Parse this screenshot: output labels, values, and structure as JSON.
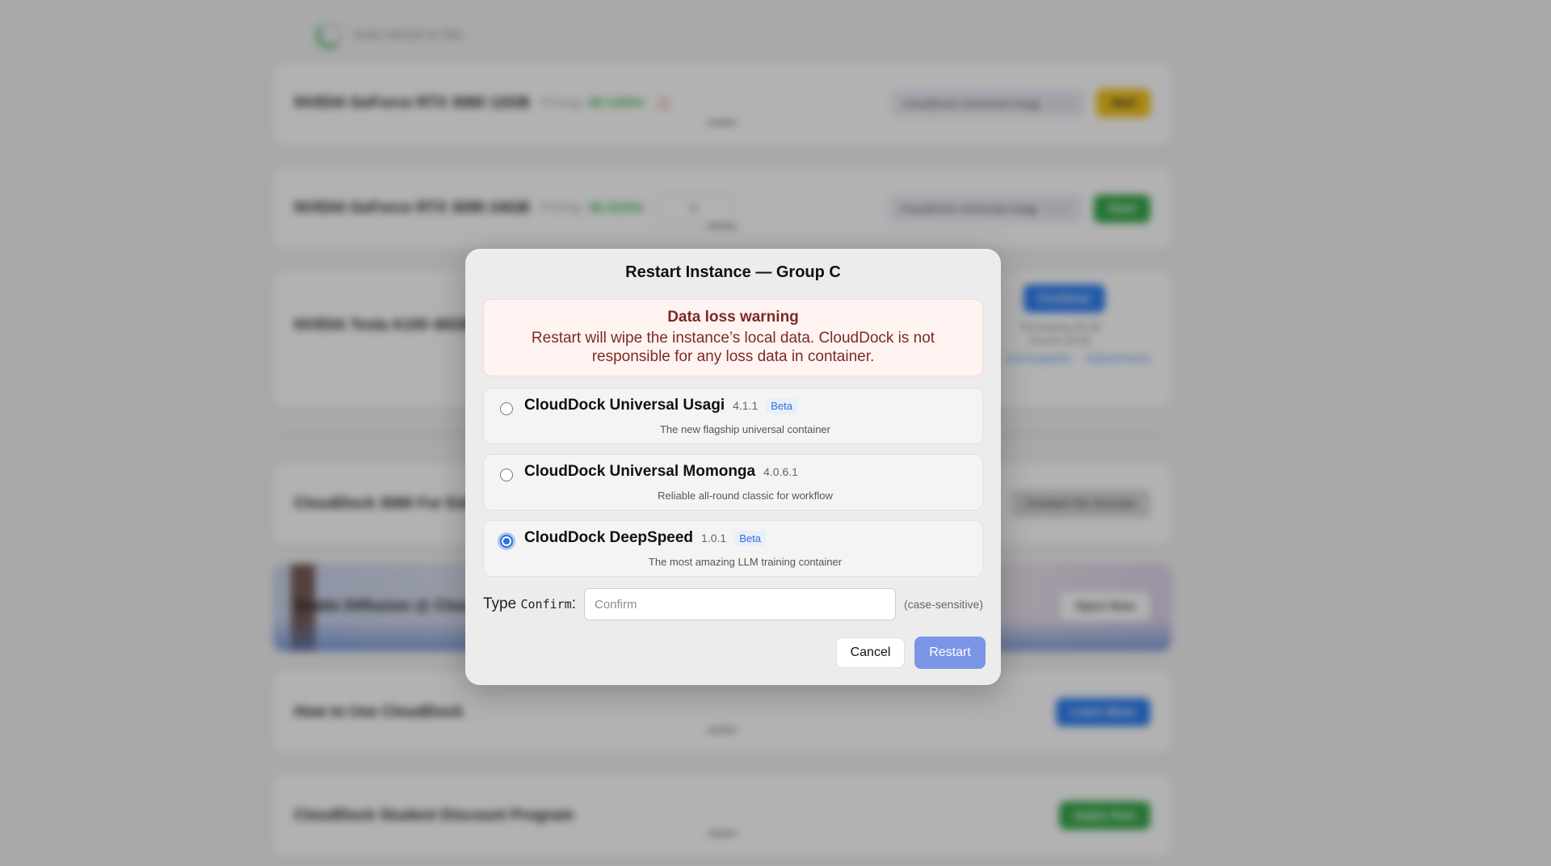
{
  "background": {
    "refresh_text": "Auto refresh in 33s",
    "cards": [
      {
        "title": "NVIDIA GeForce RTX 3060 12GB",
        "pricing_label": "Pricing:",
        "price": "$0.120/hr",
        "container": "CloudDock Universal Usagi",
        "version": "4.1.1",
        "action": "Wait"
      },
      {
        "title": "NVIDIA GeForce RTX 3090 24GB",
        "pricing_label": "Pricing:",
        "price": "$0.322/hr",
        "quantity": "1",
        "container": "CloudDock Universal Usagi",
        "version": "4.1.1",
        "action": "Start"
      },
      {
        "title": "NVIDIA Tesla A100 40GB",
        "action": "Continue",
        "remaining": "Remaining 48:48",
        "ends": "End At 23:30",
        "link1": "Full Snapshot",
        "link2": "Extend Hours"
      },
      {
        "title": "CloudDock 3060 For Education",
        "action": "Contact for Access"
      },
      {
        "title": "Stable Diffusion @ CloudDock",
        "action": "Open Now"
      },
      {
        "title": "How to Use CloudDock",
        "action": "Learn More"
      },
      {
        "title": "CloudDock Student Discount Program",
        "action": "Apply Now"
      }
    ]
  },
  "modal": {
    "title": "Restart Instance — Group C",
    "warning_title": "Data loss warning",
    "warning_body": "Restart will wipe the instance’s local data. CloudDock is not responsible for any loss data in container.",
    "options": [
      {
        "name": "CloudDock Universal Usagi",
        "version": "4.1.1",
        "badge": "Beta",
        "description": "The new flagship universal container",
        "selected": false
      },
      {
        "name": "CloudDock Universal Momonga",
        "version": "4.0.6.1",
        "badge": "",
        "description": "Reliable all-round classic for workflow",
        "selected": false
      },
      {
        "name": "CloudDock DeepSpeed",
        "version": "1.0.1",
        "badge": "Beta",
        "description": "The most amazing LLM training container",
        "selected": true
      }
    ],
    "type_prefix": "Type",
    "type_code": "Confirm",
    "type_suffix": ":",
    "confirm_placeholder": "Confirm",
    "confirm_value": "",
    "case_note": "(case-sensitive)",
    "cancel_label": "Cancel",
    "restart_label": "Restart"
  },
  "colors": {
    "accent": "#2f6fd8",
    "restart_button": "#7b95e6",
    "warning_text": "#7c2a25",
    "warning_bg": "#fff4f2"
  }
}
